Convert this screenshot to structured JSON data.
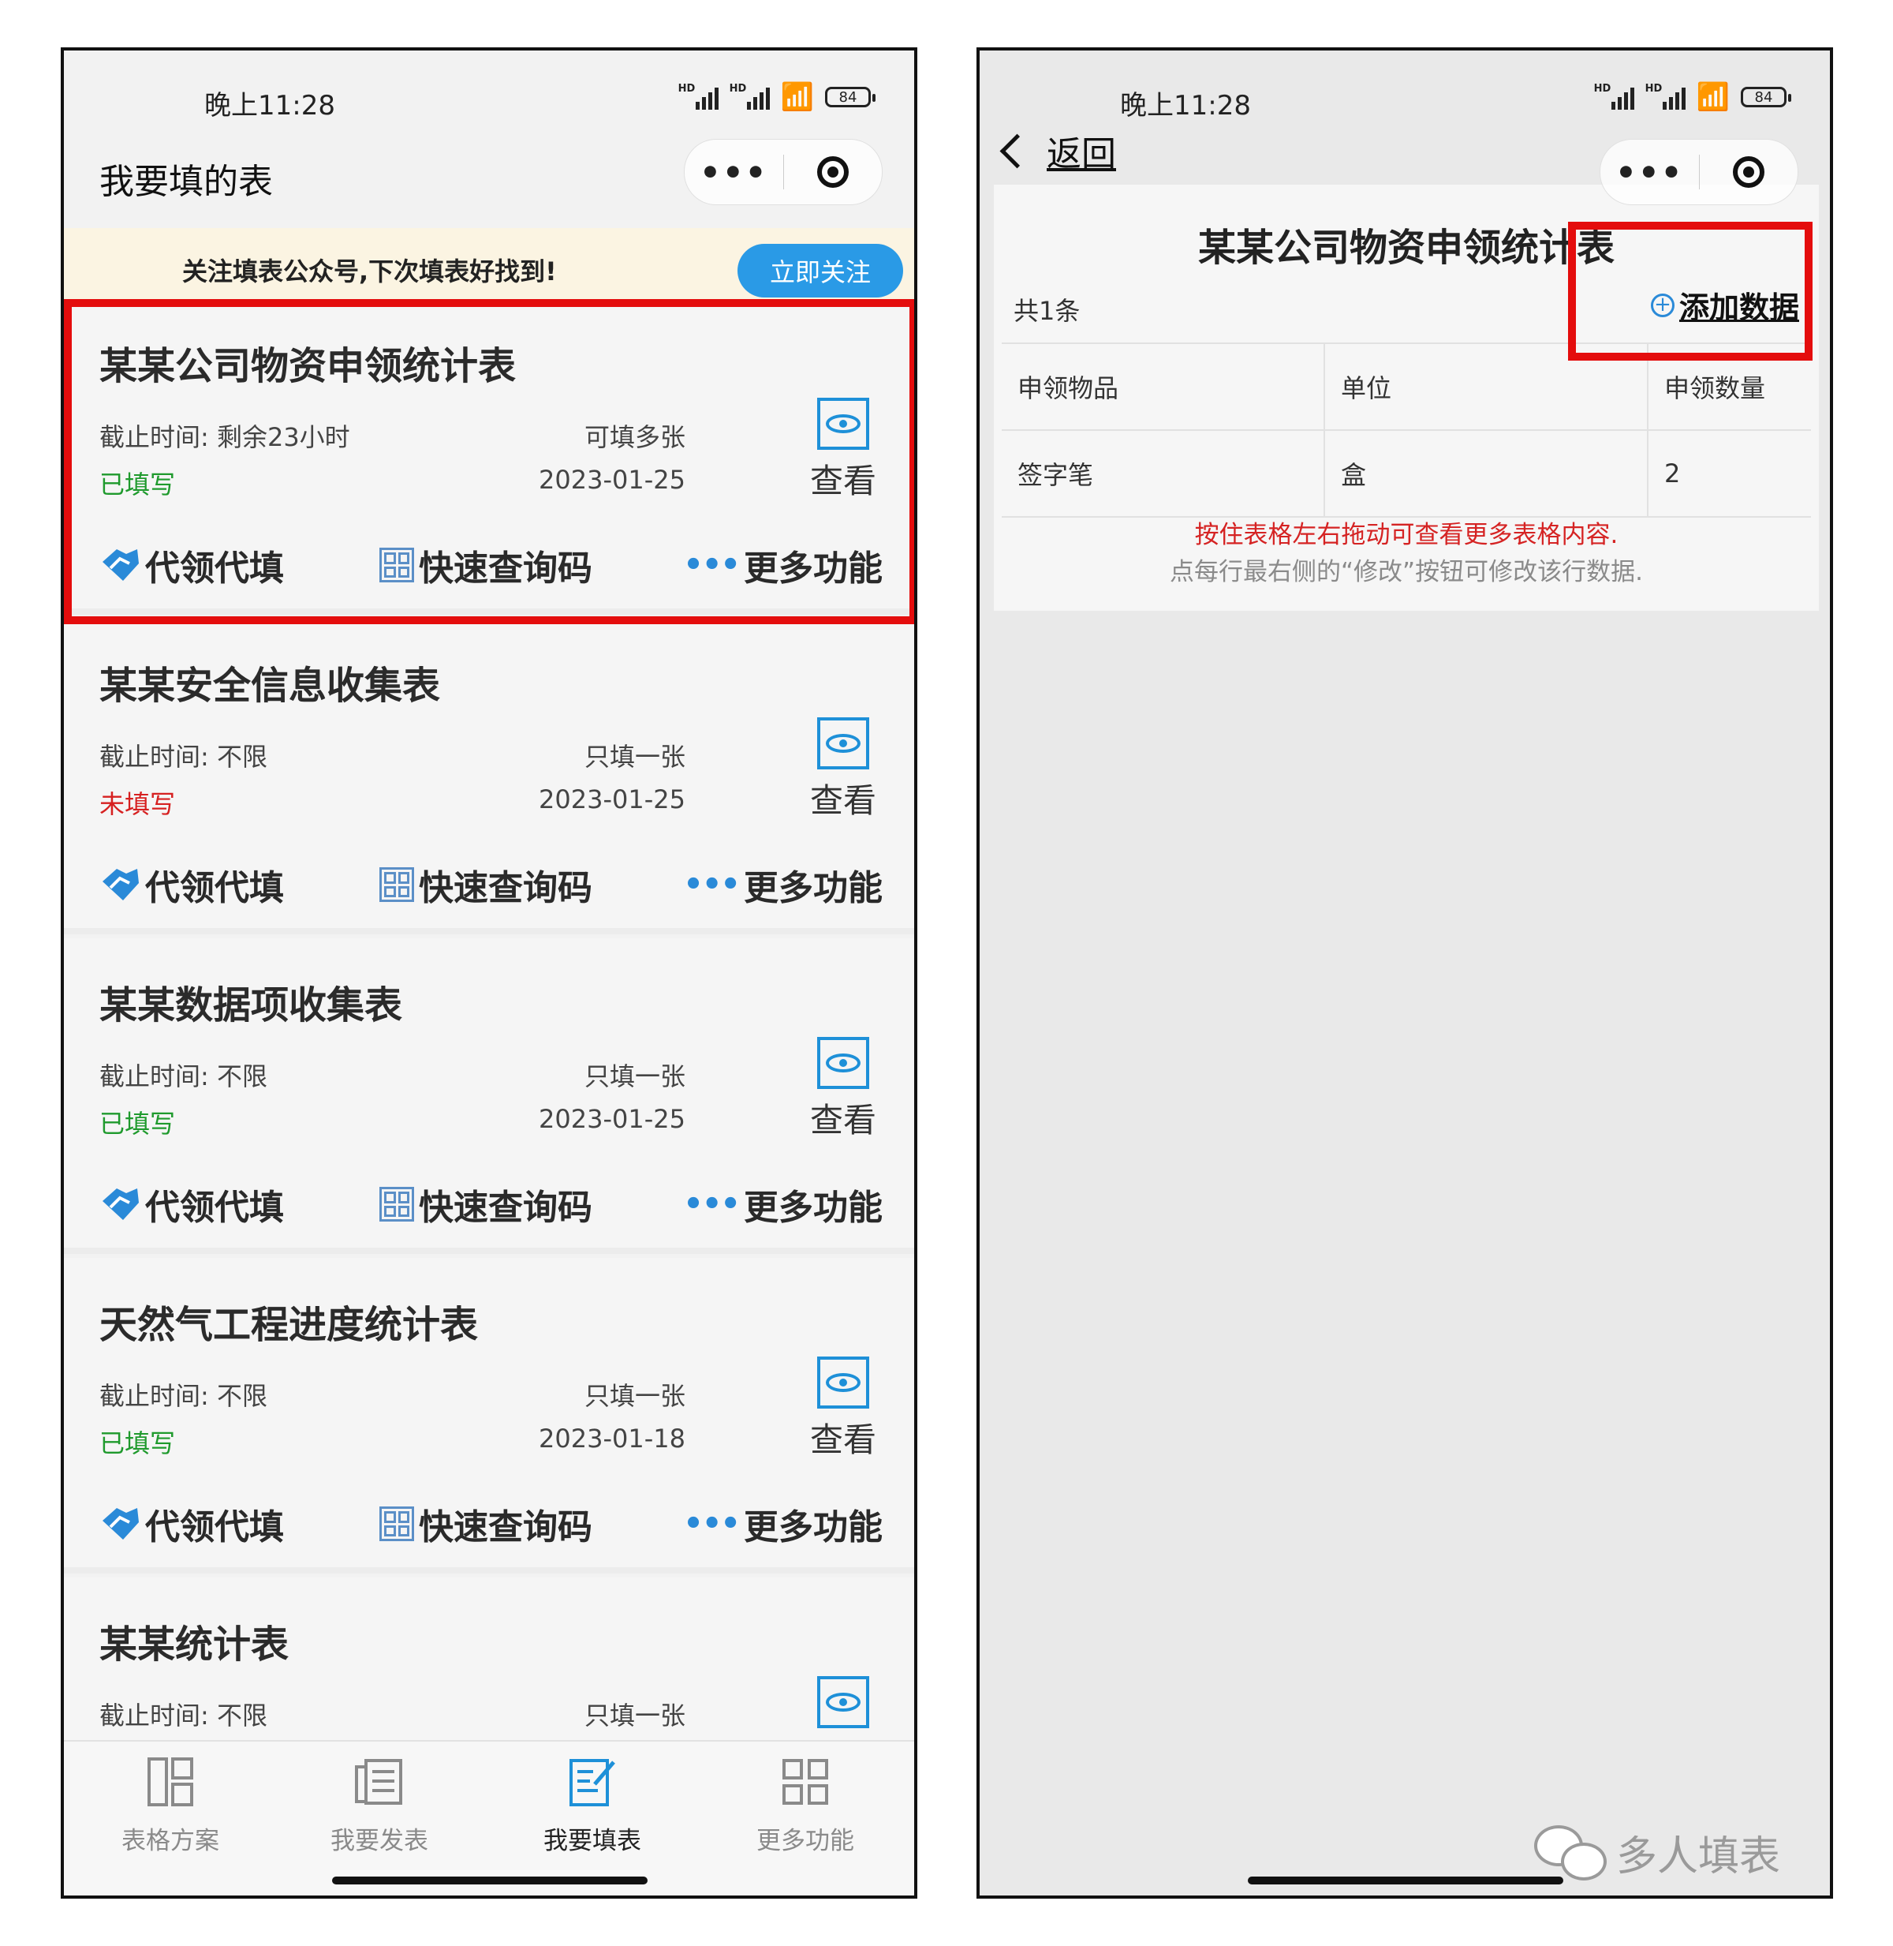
{
  "left": {
    "status_time": "晚上11:28",
    "hd_label": "HD",
    "battery": "84",
    "page_title": "我要填的表",
    "capsule_more": "•••",
    "notice_text": "关注填表公众号,下次填表好找到!",
    "follow_button": "立即关注",
    "cards": [
      {
        "title": "某某公司物资申领统计表",
        "deadline": "截止时间:  剩余23小时",
        "mode": "可填多张",
        "status": "已填写",
        "status_type": "done",
        "date": "2023-01-25"
      },
      {
        "title": "某某安全信息收集表",
        "deadline": "截止时间:  不限",
        "mode": "只填一张",
        "status": "未填写",
        "status_type": "todo",
        "date": "2023-01-25"
      },
      {
        "title": "某某数据项收集表",
        "deadline": "截止时间:  不限",
        "mode": "只填一张",
        "status": "已填写",
        "status_type": "done",
        "date": "2023-01-25"
      },
      {
        "title": "天然气工程进度统计表",
        "deadline": "截止时间:  不限",
        "mode": "只填一张",
        "status": "已填写",
        "status_type": "done",
        "date": "2023-01-18"
      },
      {
        "title": "某某统计表",
        "deadline": "截止时间:  不限",
        "mode": "只填一张",
        "status": "",
        "status_type": "done",
        "date": ""
      }
    ],
    "view_label": "查看",
    "actions": {
      "proxy": "代领代填",
      "qr": "快速查询码",
      "more": "更多功能"
    },
    "tabs": [
      "表格方案",
      "我要发表",
      "我要填表",
      "更多功能"
    ]
  },
  "right": {
    "status_time": "晚上11:28",
    "hd_label": "HD",
    "battery": "84",
    "back": "返回",
    "capsule_more": "•••",
    "sheet_title": "某某公司物资申领统计表",
    "count": "共1条",
    "add_data": "添加数据",
    "columns": [
      "申领物品",
      "单位",
      "申领数量"
    ],
    "rows": [
      [
        "签字笔",
        "盒",
        "2"
      ]
    ],
    "tip_red": "按住表格左右拖动可查看更多表格内容.",
    "tip_gray": "点每行最右侧的“修改”按钮可修改该行数据."
  },
  "watermark": "多人填表",
  "colors": {
    "accent": "#2a9ae6",
    "highlight": "#e40d0d",
    "done": "#1f9a2d",
    "todo": "#d62020"
  }
}
